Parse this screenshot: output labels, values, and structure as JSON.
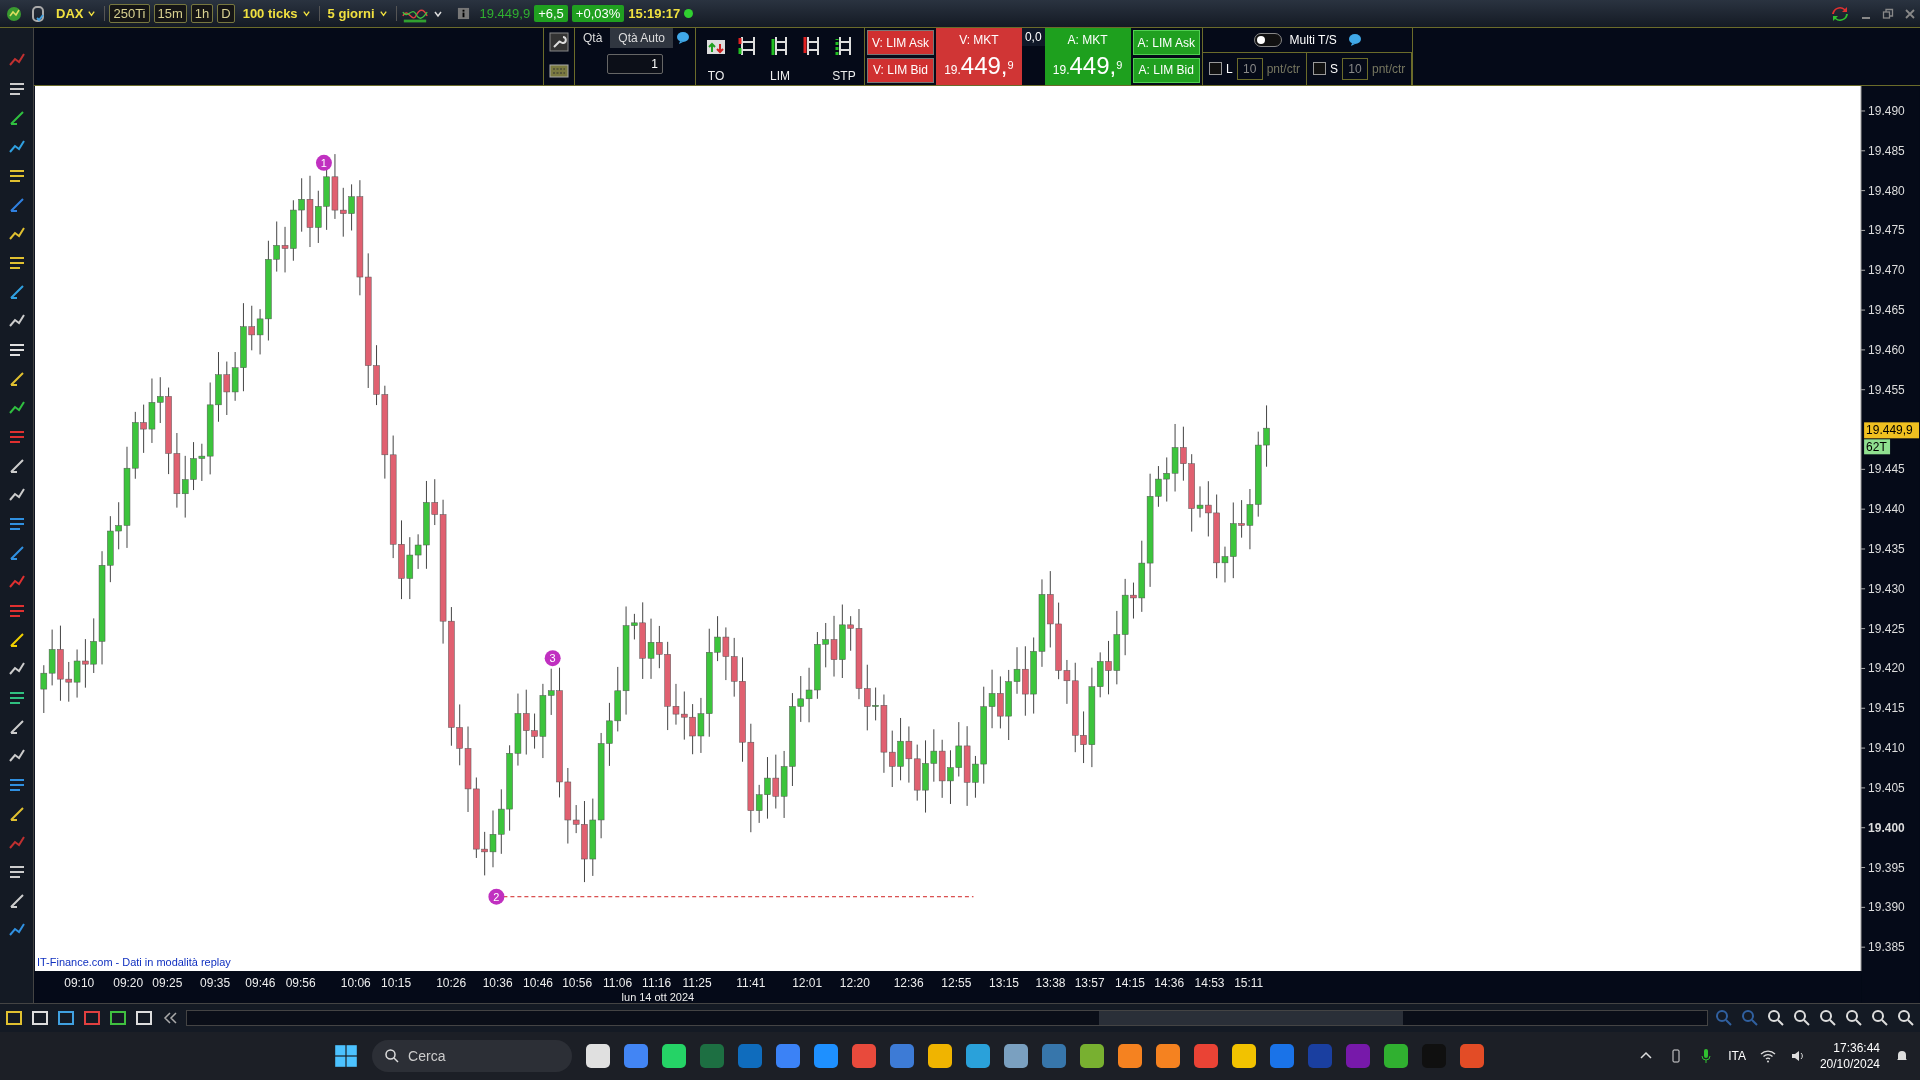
{
  "title_bar": {
    "symbol": "DAX",
    "timeframes": [
      {
        "label": "250Ti"
      },
      {
        "label": "15m"
      },
      {
        "label": "1h"
      },
      {
        "label": "D"
      }
    ],
    "period": "100 ticks",
    "range": "5 giorni",
    "last_price": "19.449,9",
    "change": "+6,5",
    "change_pct": "+0,03%",
    "time": "15:19:17"
  },
  "order_panel": {
    "tabs": [
      {
        "label": "Qtà",
        "selected": true
      },
      {
        "label": "Qtà Auto",
        "selected": false
      }
    ],
    "quantity": "1",
    "order_types": [
      {
        "label": "TO"
      },
      {
        "label": "LIM"
      },
      {
        "label": "STP"
      }
    ],
    "sell": {
      "lim_ask": "V: LIM Ask",
      "lim_bid": "V: LIM Bid",
      "mkt": "V: MKT",
      "price_prefix": "19.",
      "price_main": "449,",
      "price_decimal": "9"
    },
    "spread": "0,0",
    "buy": {
      "lim_ask": "A: LIM Ask",
      "lim_bid": "A: LIM Bid",
      "mkt": "A: MKT",
      "price_prefix": "19.",
      "price_main": "449,",
      "price_decimal": "9"
    },
    "multi_ts": {
      "label": "Multi T/S",
      "on": false
    },
    "stops": [
      {
        "label": "L",
        "checked": false,
        "value": "10",
        "unit": "pnt/ctr"
      },
      {
        "label": "S",
        "checked": false,
        "value": "10",
        "unit": "pnt/ctr"
      }
    ]
  },
  "chart": {
    "markers": [
      {
        "label": "1"
      },
      {
        "label": "2"
      },
      {
        "label": "3"
      }
    ],
    "price_labels": [
      {
        "text": "19.490",
        "major": false
      },
      {
        "text": "19.485",
        "major": false
      },
      {
        "text": "19.480",
        "major": false
      },
      {
        "text": "19.475",
        "major": false
      },
      {
        "text": "19.470",
        "major": false
      },
      {
        "text": "19.465",
        "major": false
      },
      {
        "text": "19.460",
        "major": false
      },
      {
        "text": "19.455",
        "major": false
      },
      {
        "text": "19.445",
        "major": false
      },
      {
        "text": "19.440",
        "major": false
      },
      {
        "text": "19.435",
        "major": false
      },
      {
        "text": "19.430",
        "major": false
      },
      {
        "text": "19.425",
        "major": false
      },
      {
        "text": "19.420",
        "major": false
      },
      {
        "text": "19.415",
        "major": false
      },
      {
        "text": "19.410",
        "major": false
      },
      {
        "text": "19.405",
        "major": false
      },
      {
        "text": "19.400",
        "major": true
      },
      {
        "text": "19.395",
        "major": false
      },
      {
        "text": "19.390",
        "major": false
      },
      {
        "text": "19.385",
        "major": false
      }
    ],
    "last_price_tag": "19.449,9",
    "tick_count": "62T",
    "time_labels": [
      "09:10",
      "09:20",
      "09:25",
      "09:35",
      "09:46",
      "09:56",
      "10:06",
      "10:15",
      "10:26",
      "10:36",
      "10:46",
      "10:56",
      "11:06",
      "11:16",
      "11:25",
      "11:41",
      "12:01",
      "12:20",
      "12:36",
      "12:55",
      "13:15",
      "13:38",
      "13:57",
      "14:15",
      "14:36",
      "14:53",
      "15:11"
    ],
    "date": "lun 14 ott 2024",
    "source_note": "IT-Finance.com - Dati in modalità replay"
  },
  "taskbar": {
    "search_placeholder": "Cerca",
    "language": "ITA",
    "time": "17:36:44",
    "date": "20/10/2024"
  }
}
